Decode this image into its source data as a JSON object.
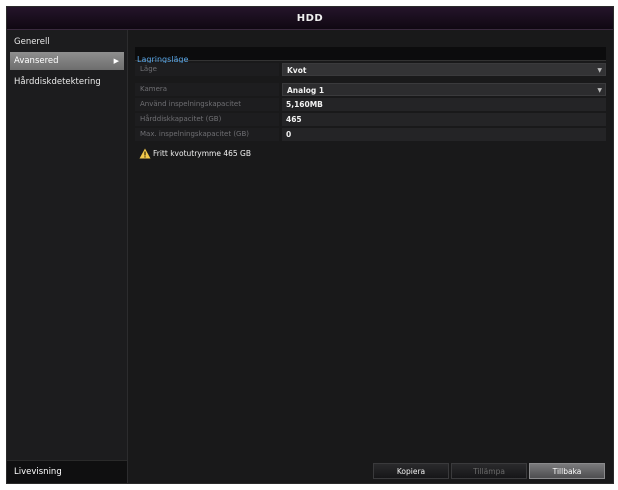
{
  "window": {
    "title": "HDD"
  },
  "sidebar": {
    "items": [
      {
        "label": "Generell"
      },
      {
        "label": "Avansered"
      },
      {
        "label": "Hårddiskdetektering"
      }
    ],
    "active_arrow": "▶",
    "bottom_label": "Livevisning"
  },
  "section": {
    "title": "Lagringsläge"
  },
  "form": {
    "mode": {
      "label": "Läge",
      "value": "Kvot"
    },
    "camera": {
      "label": "Kamera",
      "value": "Analog 1"
    },
    "used_capacity": {
      "label": "Använd inspelningskapacitet",
      "value": "5,160MB"
    },
    "hdd_capacity": {
      "label": "Hårddiskkapacitet (GB)",
      "value": "465"
    },
    "max_capacity": {
      "label": "Max. inspelningskapacitet (GB)",
      "value": "0"
    }
  },
  "note": {
    "text": "Fritt kvotutrymme 465 GB",
    "icon": "warning-icon",
    "color": "#f2c94c"
  },
  "buttons": {
    "copy": "Kopiera",
    "apply": "Tillämpa",
    "back": "Tillbaka"
  },
  "colors": {
    "link": "#5aa7e8",
    "title_bar": "#24142a",
    "active_item": "#8f8f8f"
  }
}
